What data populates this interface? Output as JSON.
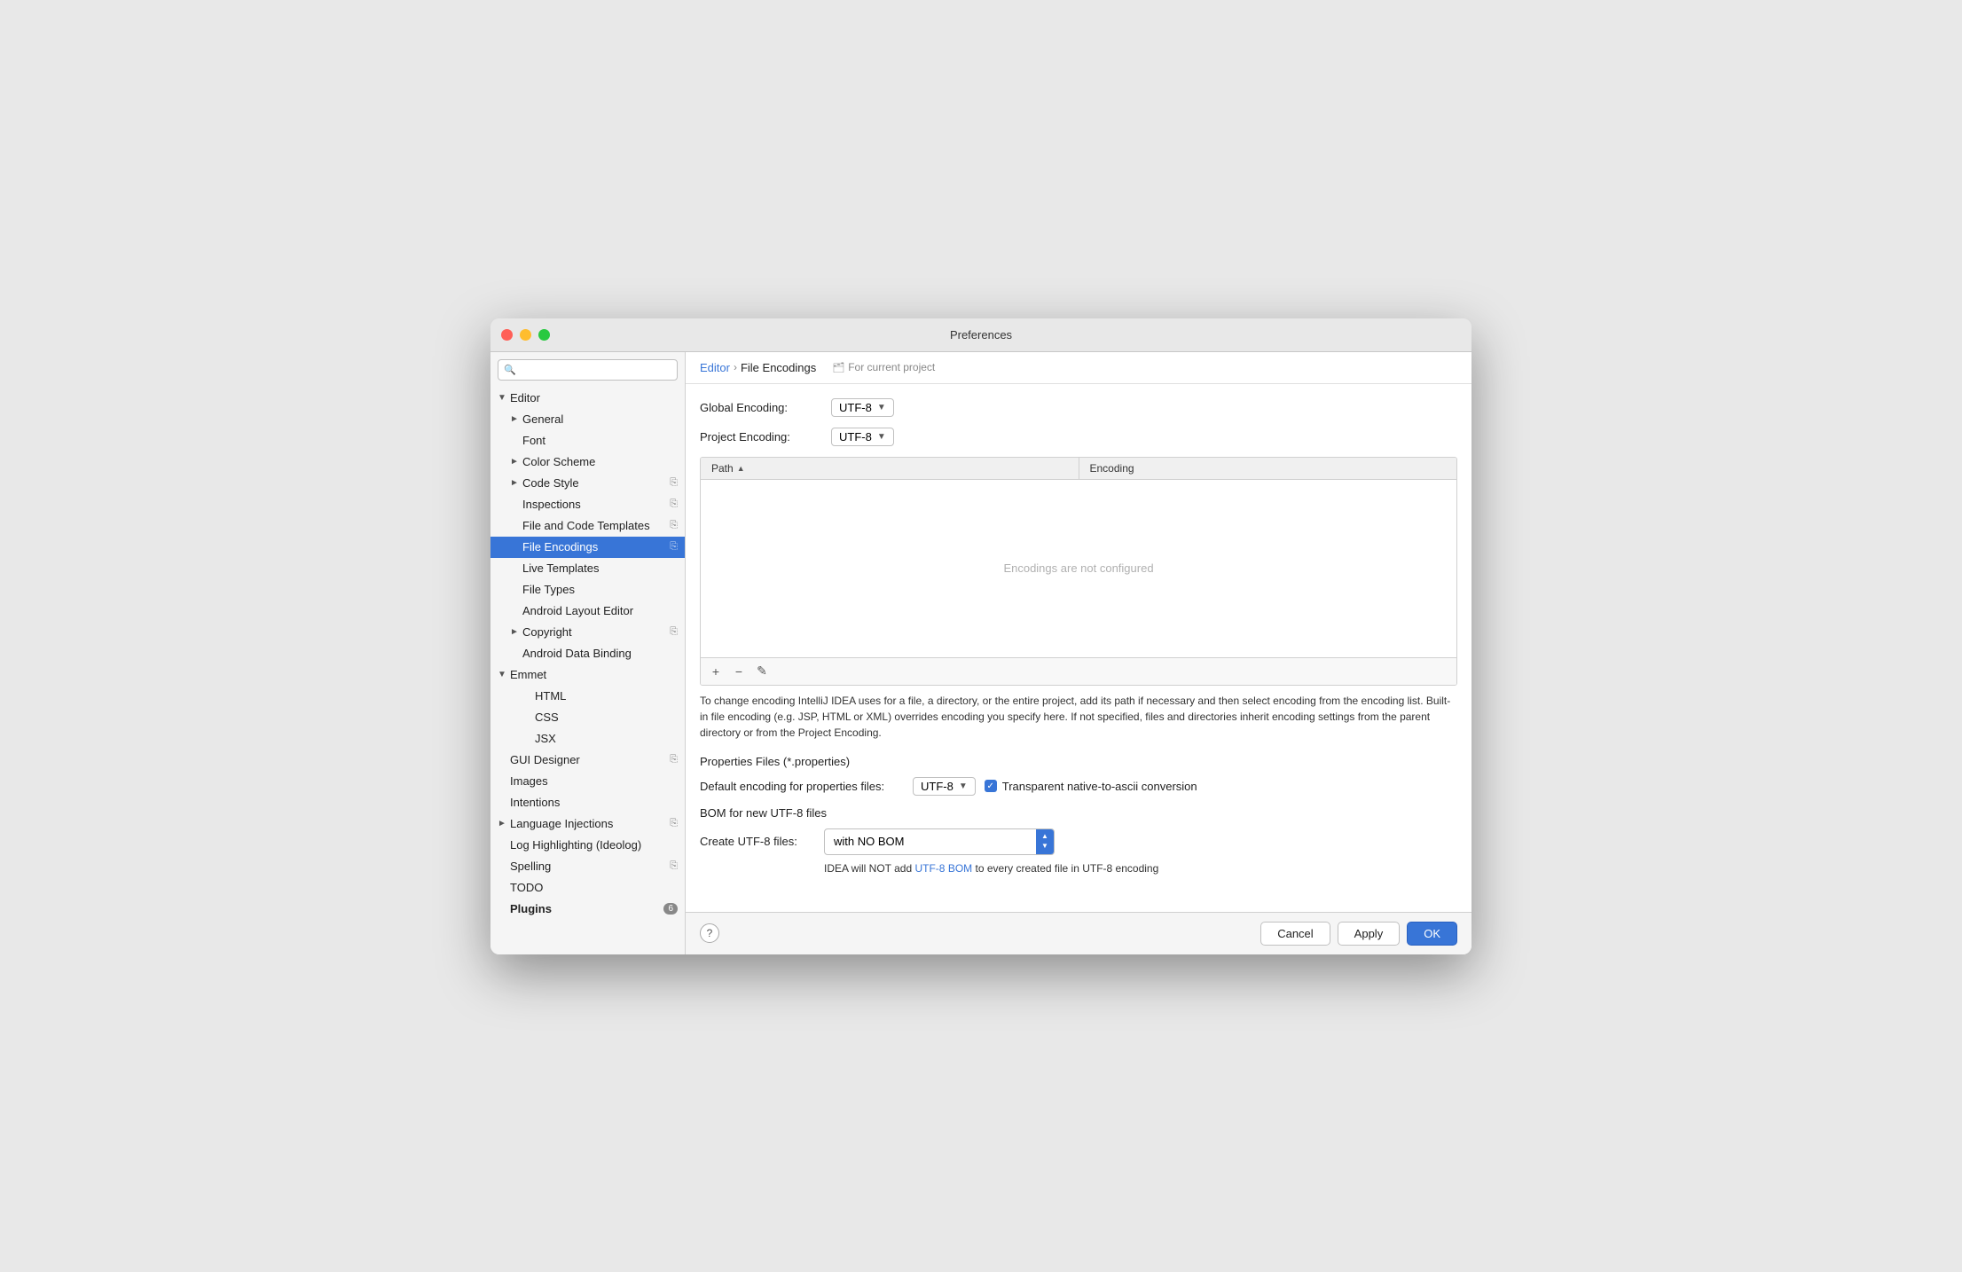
{
  "window": {
    "title": "Preferences"
  },
  "sidebar": {
    "search_placeholder": "🔍",
    "items": [
      {
        "id": "editor",
        "label": "Editor",
        "indent": 0,
        "arrow": "▼",
        "has_arrow": true
      },
      {
        "id": "general",
        "label": "General",
        "indent": 1,
        "arrow": "►",
        "has_arrow": true
      },
      {
        "id": "font",
        "label": "Font",
        "indent": 1,
        "arrow": "",
        "has_arrow": false
      },
      {
        "id": "color-scheme",
        "label": "Color Scheme",
        "indent": 1,
        "arrow": "►",
        "has_arrow": true
      },
      {
        "id": "code-style",
        "label": "Code Style",
        "indent": 1,
        "arrow": "►",
        "has_arrow": true,
        "has_icon": true
      },
      {
        "id": "inspections",
        "label": "Inspections",
        "indent": 1,
        "arrow": "",
        "has_arrow": false,
        "has_icon": true
      },
      {
        "id": "file-code-templates",
        "label": "File and Code Templates",
        "indent": 1,
        "arrow": "",
        "has_arrow": false,
        "has_icon": true
      },
      {
        "id": "file-encodings",
        "label": "File Encodings",
        "indent": 1,
        "arrow": "",
        "has_arrow": false,
        "has_icon": true,
        "active": true
      },
      {
        "id": "live-templates",
        "label": "Live Templates",
        "indent": 1,
        "arrow": "",
        "has_arrow": false
      },
      {
        "id": "file-types",
        "label": "File Types",
        "indent": 1,
        "arrow": "",
        "has_arrow": false
      },
      {
        "id": "android-layout-editor",
        "label": "Android Layout Editor",
        "indent": 1,
        "arrow": "",
        "has_arrow": false
      },
      {
        "id": "copyright",
        "label": "Copyright",
        "indent": 1,
        "arrow": "►",
        "has_arrow": true,
        "has_icon": true
      },
      {
        "id": "android-data-binding",
        "label": "Android Data Binding",
        "indent": 1,
        "arrow": "",
        "has_arrow": false
      },
      {
        "id": "emmet",
        "label": "Emmet",
        "indent": 0,
        "arrow": "▼",
        "has_arrow": true
      },
      {
        "id": "html",
        "label": "HTML",
        "indent": 2,
        "arrow": "",
        "has_arrow": false
      },
      {
        "id": "css",
        "label": "CSS",
        "indent": 2,
        "arrow": "",
        "has_arrow": false
      },
      {
        "id": "jsx",
        "label": "JSX",
        "indent": 2,
        "arrow": "",
        "has_arrow": false
      },
      {
        "id": "gui-designer",
        "label": "GUI Designer",
        "indent": 0,
        "arrow": "",
        "has_arrow": false,
        "has_icon": true
      },
      {
        "id": "images",
        "label": "Images",
        "indent": 0,
        "arrow": "",
        "has_arrow": false
      },
      {
        "id": "intentions",
        "label": "Intentions",
        "indent": 0,
        "arrow": "",
        "has_arrow": false
      },
      {
        "id": "language-injections",
        "label": "Language Injections",
        "indent": 0,
        "arrow": "►",
        "has_arrow": true,
        "has_icon": true
      },
      {
        "id": "log-highlighting",
        "label": "Log Highlighting (Ideolog)",
        "indent": 0,
        "arrow": "",
        "has_arrow": false
      },
      {
        "id": "spelling",
        "label": "Spelling",
        "indent": 0,
        "arrow": "",
        "has_arrow": false,
        "has_icon": true
      },
      {
        "id": "todo",
        "label": "TODO",
        "indent": 0,
        "arrow": "",
        "has_arrow": false
      },
      {
        "id": "plugins",
        "label": "Plugins",
        "indent": 0,
        "arrow": "",
        "has_arrow": false,
        "badge": "6",
        "is_bold": true
      }
    ]
  },
  "panel": {
    "breadcrumb_parent": "Editor",
    "breadcrumb_current": "File Encodings",
    "for_current_project": "For current project",
    "global_encoding_label": "Global Encoding:",
    "global_encoding_value": "UTF-8",
    "project_encoding_label": "Project Encoding:",
    "project_encoding_value": "UTF-8",
    "table": {
      "col_path": "Path",
      "col_encoding": "Encoding",
      "empty_message": "Encodings are not configured"
    },
    "toolbar_buttons": [
      "+",
      "−",
      "✎"
    ],
    "info_text": "To change encoding IntelliJ IDEA uses for a file, a directory, or the entire project, add its path if necessary and then select encoding from the encoding list. Built-in file encoding (e.g. JSP, HTML or XML) overrides encoding you specify here. If not specified, files and directories inherit encoding settings from the parent directory or from the Project Encoding.",
    "props_section_title": "Properties Files (*.properties)",
    "default_encoding_label": "Default encoding for properties files:",
    "default_encoding_value": "UTF-8",
    "transparent_checkbox_label": "Transparent native-to-ascii conversion",
    "bom_section_title": "BOM for new UTF-8 files",
    "create_utf8_label": "Create UTF-8 files:",
    "create_utf8_value": "with NO BOM",
    "bom_note_prefix": "IDEA will NOT add ",
    "bom_note_link": "UTF-8 BOM",
    "bom_note_suffix": " to every created file in UTF-8 encoding"
  },
  "footer": {
    "cancel_label": "Cancel",
    "apply_label": "Apply",
    "ok_label": "OK"
  }
}
